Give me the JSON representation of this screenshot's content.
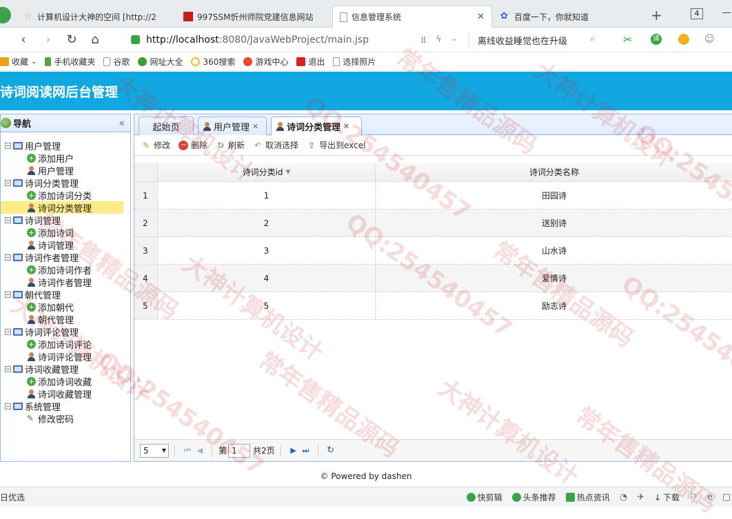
{
  "browser": {
    "tabs": [
      {
        "label": "计算机设计大神的空间 [http://2",
        "icon": "star-icon"
      },
      {
        "label": "997SSM忻州师院党建信息网站",
        "icon": "red-square-icon"
      },
      {
        "label": "信息管理系统",
        "icon": "page-icon",
        "active": true
      },
      {
        "label": "百度一下，你就知道",
        "icon": "baidu-paw-icon"
      }
    ],
    "tab_count": "4",
    "url_host": "http://localhost",
    "url_path": ":8080/JavaWebProject/main.jsp",
    "search_text": "离线收益睡觉也在升级",
    "bookmarks": [
      {
        "label": "收藏",
        "color": "#e8a317"
      },
      {
        "label": "手机收藏夹",
        "color": "#5aa23a"
      },
      {
        "label": "谷歌",
        "color": "#bbbbbb"
      },
      {
        "label": "网址大全",
        "color": "#3f9a3f"
      },
      {
        "label": "360搜索",
        "color": "#e8c217"
      },
      {
        "label": "游戏中心",
        "color": "#e54a2d"
      },
      {
        "label": "退出",
        "color": "#d8231f"
      },
      {
        "label": "选择照片",
        "color": "#bbbbbb"
      }
    ]
  },
  "app": {
    "title": "诗词阅读网后台管理",
    "header_color": "#11a7e0"
  },
  "nav": {
    "title": "导航",
    "collapse_glyph": "«",
    "groups": [
      {
        "label": "用户管理",
        "children": [
          {
            "label": "添加用户",
            "icon": "add"
          },
          {
            "label": "用户管理",
            "icon": "user"
          }
        ]
      },
      {
        "label": "诗词分类管理",
        "children": [
          {
            "label": "添加诗词分类",
            "icon": "add"
          },
          {
            "label": "诗词分类管理",
            "icon": "user",
            "selected": true
          }
        ]
      },
      {
        "label": "诗词管理",
        "children": [
          {
            "label": "添加诗词",
            "icon": "add"
          },
          {
            "label": "诗词管理",
            "icon": "user"
          }
        ]
      },
      {
        "label": "诗词作者管理",
        "children": [
          {
            "label": "添加诗词作者",
            "icon": "add"
          },
          {
            "label": "诗词作者管理",
            "icon": "user"
          }
        ]
      },
      {
        "label": "朝代管理",
        "children": [
          {
            "label": "添加朝代",
            "icon": "add"
          },
          {
            "label": "朝代管理",
            "icon": "user"
          }
        ]
      },
      {
        "label": "诗词评论管理",
        "children": [
          {
            "label": "添加诗词评论",
            "icon": "add"
          },
          {
            "label": "诗词评论管理",
            "icon": "user"
          }
        ]
      },
      {
        "label": "诗词收藏管理",
        "children": [
          {
            "label": "添加诗词收藏",
            "icon": "add"
          },
          {
            "label": "诗词收藏管理",
            "icon": "user"
          }
        ]
      },
      {
        "label": "系统管理",
        "children": [
          {
            "label": "修改密码",
            "icon": "pen"
          }
        ]
      }
    ]
  },
  "center": {
    "tabs": [
      {
        "label": "起始页",
        "closable": false
      },
      {
        "label": "用户管理",
        "closable": true
      },
      {
        "label": "诗词分类管理",
        "closable": true,
        "active": true
      }
    ],
    "toolbar": {
      "edit": "修改",
      "delete": "删除",
      "refresh": "刷新",
      "cancel_select": "取消选择",
      "export": "导出到excel"
    },
    "grid": {
      "columns": [
        "诗词分类id",
        "诗词分类名称"
      ],
      "rows": [
        {
          "num": "1",
          "id": "1",
          "name": "田园诗"
        },
        {
          "num": "2",
          "id": "2",
          "name": "送别诗"
        },
        {
          "num": "3",
          "id": "3",
          "name": "山水诗"
        },
        {
          "num": "4",
          "id": "4",
          "name": "爱情诗"
        },
        {
          "num": "5",
          "id": "5",
          "name": "励志诗"
        }
      ]
    },
    "pager": {
      "page_size": "5",
      "page_prefix": "第",
      "page_value": "1",
      "total_pages": "共2页"
    }
  },
  "footer": "© Powered by dashen",
  "statusbar": {
    "left": "日优选",
    "items": [
      "快剪辑",
      "头条推荐",
      "热点资讯",
      "下载"
    ]
  },
  "watermark": {
    "lines": [
      "大神计算机设计",
      "QQ:254540457",
      "常年售精品源码"
    ]
  }
}
